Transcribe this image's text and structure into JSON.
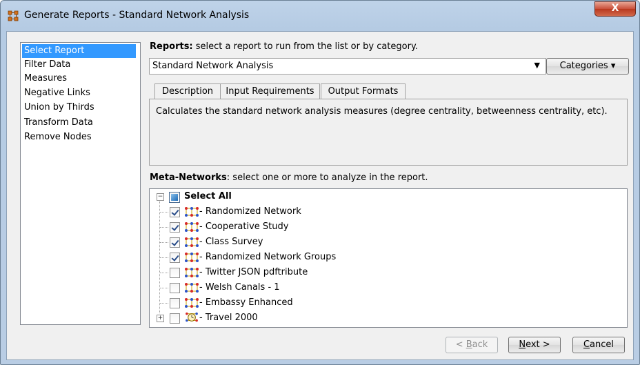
{
  "window": {
    "title": "Generate Reports - Standard Network Analysis",
    "close_glyph": "X"
  },
  "nav": {
    "items": [
      {
        "label": "Select Report",
        "selected": true
      },
      {
        "label": "Filter Data",
        "selected": false
      },
      {
        "label": "Measures",
        "selected": false
      },
      {
        "label": "Negative Links",
        "selected": false
      },
      {
        "label": "Union by Thirds",
        "selected": false
      },
      {
        "label": "Transform Data",
        "selected": false
      },
      {
        "label": "Remove Nodes",
        "selected": false
      }
    ]
  },
  "reports": {
    "label_bold": "Reports:",
    "label_rest": " select a report to run from the list or by category.",
    "selected_report": "Standard Network Analysis",
    "dropdown_arrow": "▼",
    "categories_label": "Categories ▾"
  },
  "tabs": [
    {
      "label": "Description",
      "active": true
    },
    {
      "label": "Input Requirements",
      "active": false
    },
    {
      "label": "Output Formats",
      "active": false
    }
  ],
  "description_text": "Calculates the standard network analysis measures (degree centrality, betweenness centrality, etc).",
  "meta_networks": {
    "label_bold": "Meta-Networks",
    "label_rest": ": select one or more to analyze in the report.",
    "select_all_label": "Select All",
    "items": [
      {
        "label": "Randomized Network",
        "checked": true,
        "icon": "network-icon"
      },
      {
        "label": "Cooperative Study",
        "checked": true,
        "icon": "network-icon"
      },
      {
        "label": "Class Survey",
        "checked": true,
        "icon": "network-icon"
      },
      {
        "label": "Randomized Network Groups",
        "checked": true,
        "icon": "network-icon"
      },
      {
        "label": "Twitter JSON pdftribute",
        "checked": false,
        "icon": "network-icon"
      },
      {
        "label": "Welsh Canals - 1",
        "checked": false,
        "icon": "network-icon"
      },
      {
        "label": "Embassy Enhanced",
        "checked": false,
        "icon": "network-icon"
      },
      {
        "label": "Travel 2000",
        "checked": false,
        "icon": "time-network-icon",
        "expandable": true
      }
    ]
  },
  "buttons": {
    "back_pre": "< ",
    "back_u": "B",
    "back_post": "ack",
    "next_u": "N",
    "next_post": "ext >",
    "cancel_u": "C",
    "cancel_post": "ancel"
  },
  "colors": {
    "selection": "#3399ff",
    "title_gradient_top": "#bfd3e9",
    "close_button": "#c94f3a"
  }
}
